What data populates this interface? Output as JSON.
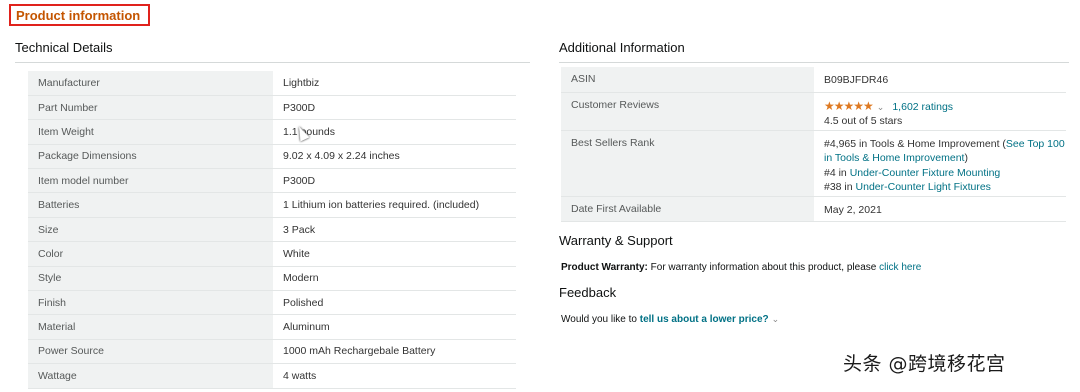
{
  "header": {
    "title": "Product information"
  },
  "technical_details": {
    "heading": "Technical Details",
    "rows": [
      {
        "label": "Manufacturer",
        "value": "Lightbiz"
      },
      {
        "label": "Part Number",
        "value": "P300D"
      },
      {
        "label": "Item Weight",
        "value": "1.1 pounds"
      },
      {
        "label": "Package Dimensions",
        "value": "9.02 x 4.09 x 2.24 inches"
      },
      {
        "label": "Item model number",
        "value": "P300D"
      },
      {
        "label": "Batteries",
        "value": "1 Lithium ion batteries required. (included)"
      },
      {
        "label": "Size",
        "value": "3 Pack"
      },
      {
        "label": "Color",
        "value": "White"
      },
      {
        "label": "Style",
        "value": "Modern"
      },
      {
        "label": "Finish",
        "value": "Polished"
      },
      {
        "label": "Material",
        "value": "Aluminum"
      },
      {
        "label": "Power Source",
        "value": "1000 mAh Rechargebale Battery"
      },
      {
        "label": "Wattage",
        "value": "4 watts"
      }
    ]
  },
  "additional_information": {
    "heading": "Additional Information",
    "asin_label": "ASIN",
    "asin_value": "B09BJFDR46",
    "reviews_label": "Customer Reviews",
    "reviews_stars": "★★★★★",
    "reviews_rating": 4.5,
    "reviews_count": "1,602 ratings",
    "reviews_text": "4.5 out of 5 stars",
    "rank_label": "Best Sellers Rank",
    "rank_line1_text": "#4,965 in Tools & Home Improvement (",
    "rank_line1_link": "See Top 100 in Tools & Home Improvement",
    "rank_line1_end": ")",
    "rank_line2_prefix": "#4 in ",
    "rank_line2_link": "Under-Counter Fixture Mounting",
    "rank_line3_prefix": "#38 in ",
    "rank_line3_link": "Under-Counter Light Fixtures",
    "date_label": "Date First Available",
    "date_value": "May 2, 2021"
  },
  "warranty": {
    "heading": "Warranty & Support",
    "label": "Product Warranty:",
    "text": "For warranty information about this product, please",
    "link": "click here"
  },
  "feedback": {
    "heading": "Feedback",
    "text": "Would you like to",
    "link": "tell us about a lower price?"
  },
  "watermark": "头条 @跨境移花宫",
  "colors": {
    "title_orange": "#c45500",
    "highlight_red": "#e0221c",
    "link_teal": "#007185",
    "star_orange": "#de7921",
    "label_bg": "#f0f2f2"
  }
}
